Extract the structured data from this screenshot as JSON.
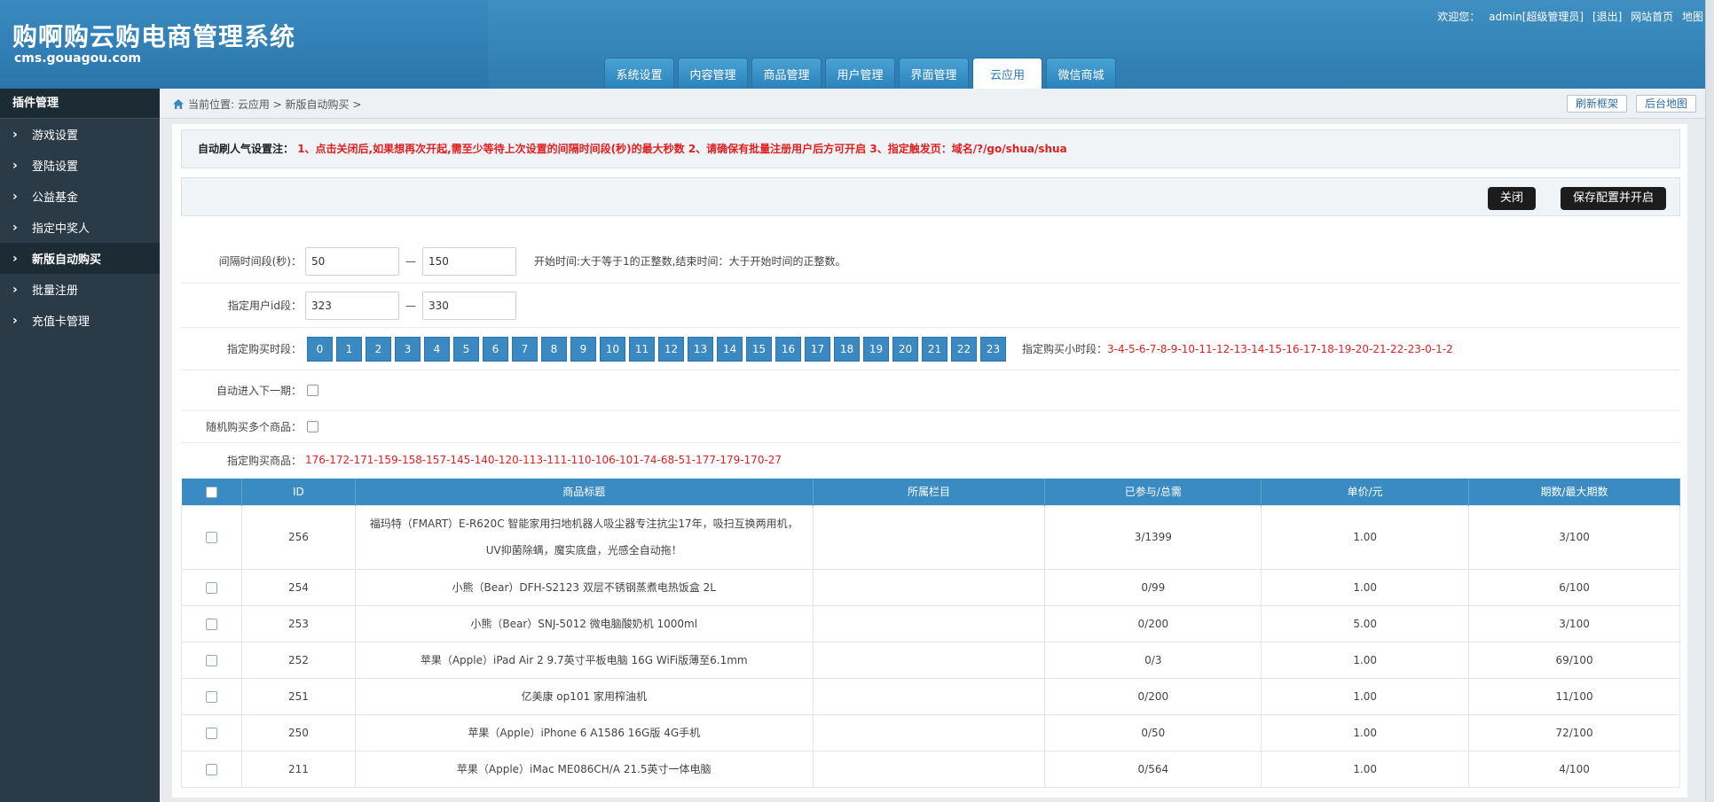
{
  "header": {
    "title": "购啊购云购电商管理系统",
    "subtitle": "cms.gouagou.com",
    "welcome": "欢迎您：",
    "user": "admin",
    "role": "[超级管理员]",
    "logout": "[退出]",
    "site_home": "网站首页",
    "map": "地图"
  },
  "tabs": [
    "系统设置",
    "内容管理",
    "商品管理",
    "用户管理",
    "界面管理",
    "云应用",
    "微信商城"
  ],
  "active_tab": 5,
  "sidebar": {
    "title": "插件管理",
    "items": [
      "游戏设置",
      "登陆设置",
      "公益基金",
      "指定中奖人",
      "新版自动购买",
      "批量注册",
      "充值卡管理"
    ],
    "active_index": 4
  },
  "breadcrumb": {
    "text": "当前位置: 云应用 > 新版自动购买 >",
    "refresh": "刷新框架",
    "sitemap": "后台地图"
  },
  "notice": {
    "label": "自动刷人气设置注：",
    "text": "1、点击关闭后,如果想再次开起,需至少等待上次设置的间隔时间段(秒)的最大秒数 2、请确保有批量注册用户后方可开启 3、指定触发页：域名/?/go/shua/shua"
  },
  "actions": {
    "close": "关闭",
    "save": "保存配置并开启"
  },
  "form": {
    "interval_label": "间隔时间段(秒)：",
    "interval_min": "50",
    "interval_max": "150",
    "interval_hint": "开始时间:大于等于1的正整数,结束时间：大于开始时间的正整数。",
    "uid_label": "指定用户id段：",
    "uid_min": "323",
    "uid_max": "330",
    "dash": "—",
    "hours_label": "指定购买时段：",
    "hours": [
      "0",
      "1",
      "2",
      "3",
      "4",
      "5",
      "6",
      "7",
      "8",
      "9",
      "10",
      "11",
      "12",
      "13",
      "14",
      "15",
      "16",
      "17",
      "18",
      "19",
      "20",
      "21",
      "22",
      "23"
    ],
    "hours_selected_label": "指定购买小时段：",
    "hours_selected": "3-4-5-6-7-8-9-10-11-12-13-14-15-16-17-18-19-20-21-22-23-0-1-2",
    "next_period_label": "自动进入下一期：",
    "random_multi_label": "随机购买多个商品：",
    "goods_label": "指定购买商品：",
    "goods": "176-172-171-159-158-157-145-140-120-113-111-110-106-101-74-68-51-177-179-170-27"
  },
  "table": {
    "headers": [
      "",
      "ID",
      "商品标题",
      "所属栏目",
      "已参与/总需",
      "单价/元",
      "期数/最大期数"
    ],
    "rows": [
      {
        "id": "256",
        "title": "福玛特（FMART）E-R620C 智能家用扫地机器人吸尘器专注抗尘17年，吸扫互换两用机，UV抑菌除螨，魔实底盘，光感全自动拖！",
        "cat": "",
        "joined": "3/1399",
        "price": "1.00",
        "period": "3/100"
      },
      {
        "id": "254",
        "title": "小熊（Bear）DFH-S2123 双层不锈钢蒸煮电热饭盒 2L",
        "cat": "",
        "joined": "0/99",
        "price": "1.00",
        "period": "6/100"
      },
      {
        "id": "253",
        "title": "小熊（Bear）SNJ-5012 微电脑酸奶机 1000ml",
        "cat": "",
        "joined": "0/200",
        "price": "5.00",
        "period": "3/100"
      },
      {
        "id": "252",
        "title": "苹果（Apple）iPad Air 2 9.7英寸平板电脑 16G WiFi版薄至6.1mm",
        "cat": "",
        "joined": "0/3",
        "price": "1.00",
        "period": "69/100"
      },
      {
        "id": "251",
        "title": "亿美康 op101 家用榨油机",
        "cat": "",
        "joined": "0/200",
        "price": "1.00",
        "period": "11/100"
      },
      {
        "id": "250",
        "title": "苹果（Apple）iPhone 6 A1586 16G版 4G手机",
        "cat": "",
        "joined": "0/50",
        "price": "1.00",
        "period": "72/100"
      },
      {
        "id": "211",
        "title": "苹果（Apple）iMac ME086CH/A 21.5英寸一体电脑",
        "cat": "",
        "joined": "0/564",
        "price": "1.00",
        "period": "4/100"
      }
    ]
  }
}
